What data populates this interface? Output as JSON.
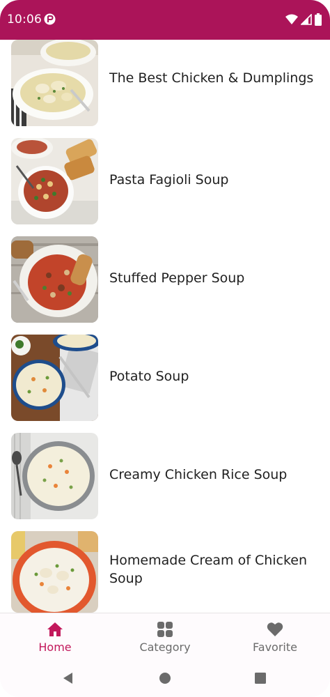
{
  "status_bar": {
    "time": "10:06",
    "background": "#ab1459",
    "icons": [
      "app-notification-icon",
      "wifi-icon",
      "signal-icon",
      "battery-icon"
    ]
  },
  "recipes": [
    {
      "title": "The Best Chicken & Dumplings",
      "image": "chicken-dumplings-photo"
    },
    {
      "title": "Pasta Fagioli Soup",
      "image": "pasta-fagioli-photo"
    },
    {
      "title": "Stuffed Pepper Soup",
      "image": "stuffed-pepper-soup-photo"
    },
    {
      "title": "Potato Soup",
      "image": "potato-soup-photo"
    },
    {
      "title": "Creamy Chicken Rice Soup",
      "image": "chicken-rice-soup-photo"
    },
    {
      "title": "Homemade Cream of Chicken Soup",
      "image": "cream-of-chicken-soup-photo"
    }
  ],
  "bottom_nav": {
    "items": [
      {
        "label": "Home",
        "icon": "home-icon",
        "active": true
      },
      {
        "label": "Category",
        "icon": "category-grid-icon",
        "active": false
      },
      {
        "label": "Favorite",
        "icon": "heart-icon",
        "active": false
      }
    ],
    "active_color": "#c2185b",
    "inactive_color": "#6b6b6b"
  },
  "system_nav": {
    "buttons": [
      "back-icon",
      "home-circle-icon",
      "recents-icon"
    ]
  }
}
